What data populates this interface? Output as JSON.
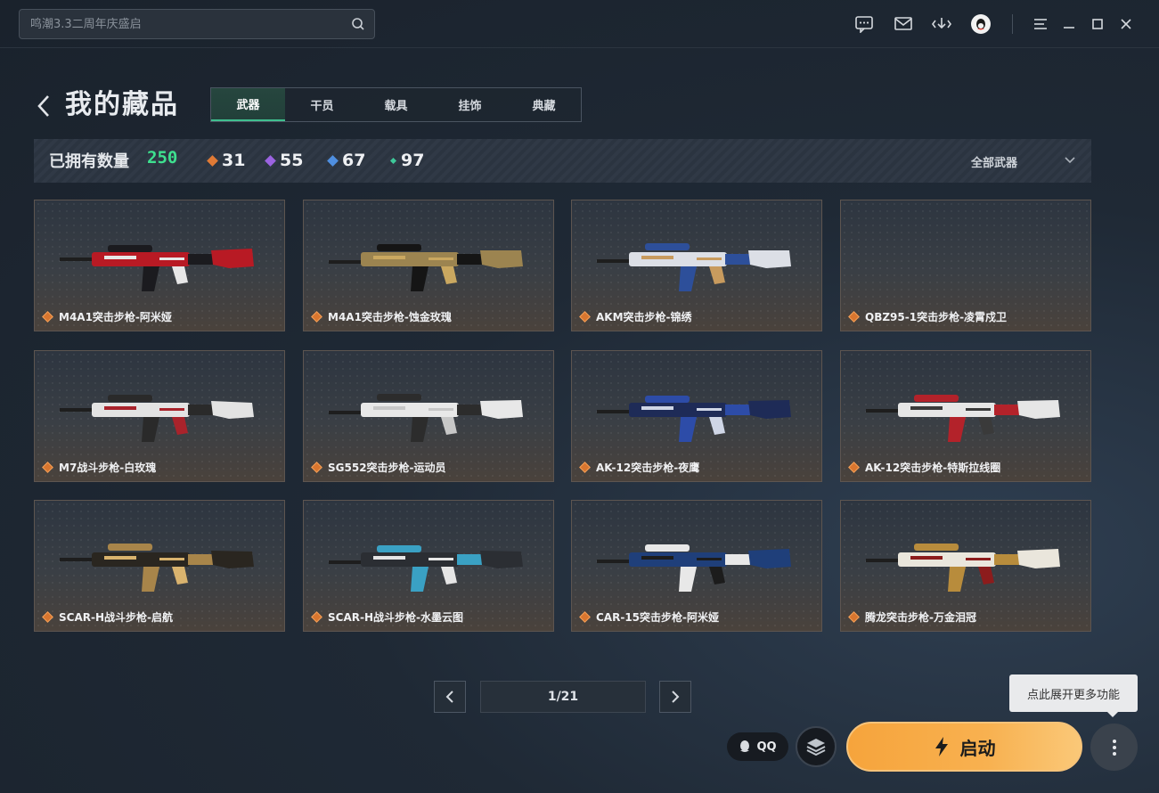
{
  "search": {
    "placeholder": "鸣潮3.3二周年庆盛启"
  },
  "header": {
    "title": "我的藏品"
  },
  "tabs": [
    {
      "label": "武器",
      "active": true
    },
    {
      "label": "干员",
      "active": false
    },
    {
      "label": "载具",
      "active": false
    },
    {
      "label": "挂饰",
      "active": false
    },
    {
      "label": "典藏",
      "active": false
    }
  ],
  "stats": {
    "owned_label": "已拥有数量",
    "owned_count": "250",
    "rarities": [
      {
        "count": "31",
        "color": "#e07a35"
      },
      {
        "count": "55",
        "color": "#9b63e0"
      },
      {
        "count": "67",
        "color": "#4f8fe0"
      },
      {
        "count": "97",
        "color": "#3ec99a"
      }
    ],
    "filter": "全部武器"
  },
  "items": [
    {
      "name": "M4A1突击步枪-阿米娅",
      "body": "#b81a24",
      "accent": "#1b1b1f",
      "trim": "#e7e7e7"
    },
    {
      "name": "M4A1突击步枪-蚀金玫瑰",
      "body": "#9c8450",
      "accent": "#151515",
      "trim": "#caa860"
    },
    {
      "name": "AKM突击步枪-锦绣",
      "body": "#dcdfe6",
      "accent": "#2d4f9a",
      "trim": "#c89b5e"
    },
    {
      "name": "QBZ95-1突击步枪-凌霄戍卫",
      "body": "",
      "accent": "",
      "trim": ""
    },
    {
      "name": "M7战斗步枪-白玫瑰",
      "body": "#e3e3e3",
      "accent": "#2a2a2a",
      "trim": "#a9232b"
    },
    {
      "name": "SG552突击步枪-运动员",
      "body": "#e8e8e8",
      "accent": "#2c2c2c",
      "trim": "#c7c7c7"
    },
    {
      "name": "AK-12突击步枪-夜鹰",
      "body": "#1e2b57",
      "accent": "#2d4ca8",
      "trim": "#cfd6e6"
    },
    {
      "name": "AK-12突击步枪-特斯拉线圈",
      "body": "#e6e6e6",
      "accent": "#b3222a",
      "trim": "#3a3a3a"
    },
    {
      "name": "SCAR-H战斗步枪-启航",
      "body": "#2a2620",
      "accent": "#a8854a",
      "trim": "#d9b36e"
    },
    {
      "name": "SCAR-H战斗步枪-水墨云图",
      "body": "#2b2e33",
      "accent": "#3aa1c4",
      "trim": "#e5e5e5"
    },
    {
      "name": "CAR-15突击步枪-阿米娅",
      "body": "#1f3f7a",
      "accent": "#e8e8e8",
      "trim": "#1c1c1c"
    },
    {
      "name": "腾龙突击步枪-万金泪冠",
      "body": "#eae6dc",
      "accent": "#b88c3c",
      "trim": "#8c1c1c"
    }
  ],
  "pager": {
    "page": "1/21"
  },
  "tooltip": "点此展开更多功能",
  "qq_label": "QQ",
  "launch_label": "启动"
}
